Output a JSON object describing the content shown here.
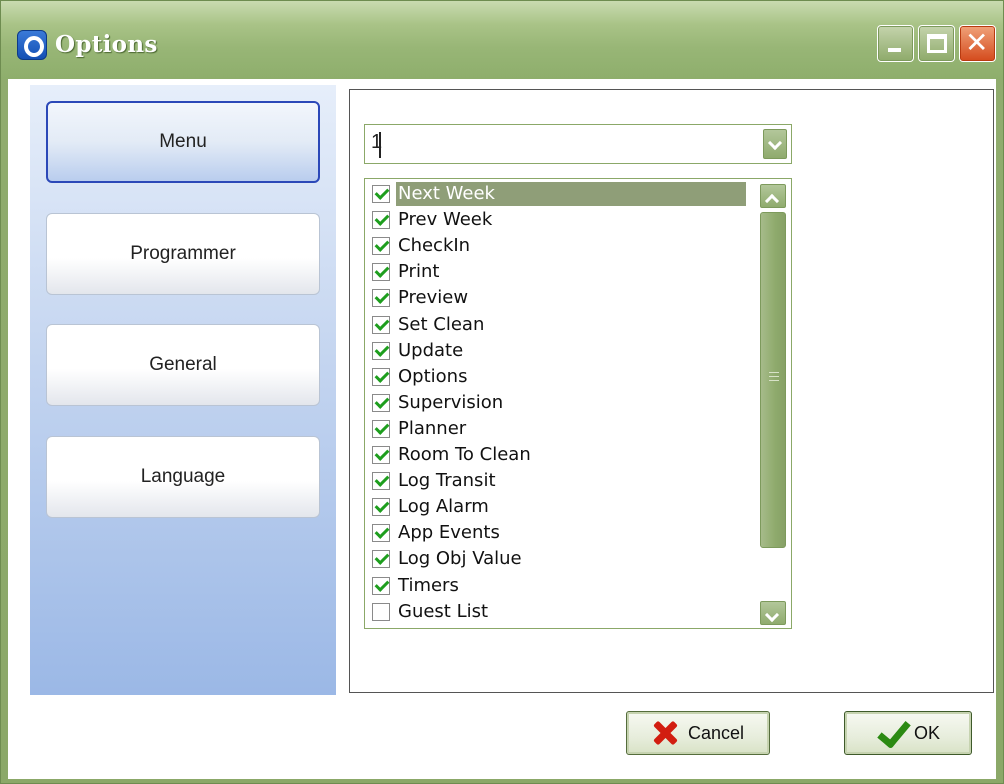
{
  "window": {
    "title": "Options",
    "controls": {
      "minimize": "minimize-icon",
      "maximize": "maximize-icon",
      "close": "close-icon"
    }
  },
  "sidebar": {
    "items": [
      {
        "label": "Menu",
        "active": true
      },
      {
        "label": "Programmer",
        "active": false
      },
      {
        "label": "General",
        "active": false
      },
      {
        "label": "Language",
        "active": false
      }
    ]
  },
  "main": {
    "combo_value": "1",
    "list_items": [
      {
        "label": "Next Week",
        "checked": true,
        "selected": true
      },
      {
        "label": "Prev Week",
        "checked": true
      },
      {
        "label": "CheckIn",
        "checked": true
      },
      {
        "label": "Print",
        "checked": true
      },
      {
        "label": "Preview",
        "checked": true
      },
      {
        "label": "Set Clean",
        "checked": true
      },
      {
        "label": "Update",
        "checked": true
      },
      {
        "label": "Options",
        "checked": true
      },
      {
        "label": "Supervision",
        "checked": true
      },
      {
        "label": "Planner",
        "checked": true
      },
      {
        "label": "Room To Clean",
        "checked": true
      },
      {
        "label": "Log Transit",
        "checked": true
      },
      {
        "label": "Log Alarm",
        "checked": true
      },
      {
        "label": "App Events",
        "checked": true
      },
      {
        "label": "Log Obj Value",
        "checked": true
      },
      {
        "label": "Timers",
        "checked": true
      },
      {
        "label": "Guest List",
        "checked": false
      }
    ]
  },
  "footer": {
    "cancel_label": "Cancel",
    "ok_label": "OK"
  },
  "colors": {
    "frame": "#8eae6c",
    "sidebar_top": "#e6eefa",
    "sidebar_bottom": "#9bb8e6",
    "selection": "#8f9e78",
    "check": "#1e9e1e"
  }
}
